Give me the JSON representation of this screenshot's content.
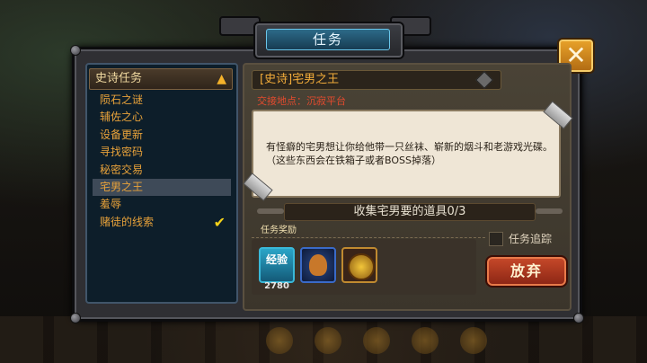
{
  "window": {
    "title": "任务"
  },
  "list": {
    "category": "史诗任务",
    "items": [
      {
        "label": "陨石之谜",
        "selected": false,
        "completed": false
      },
      {
        "label": "辅佐之心",
        "selected": false,
        "completed": false
      },
      {
        "label": "设备更新",
        "selected": false,
        "completed": false
      },
      {
        "label": "寻找密码",
        "selected": false,
        "completed": false
      },
      {
        "label": "秘密交易",
        "selected": false,
        "completed": false
      },
      {
        "label": "宅男之王",
        "selected": true,
        "completed": false
      },
      {
        "label": "羞辱",
        "selected": false,
        "completed": false
      },
      {
        "label": "赌徒的线索",
        "selected": false,
        "completed": true
      }
    ]
  },
  "quest": {
    "title": "[史诗]宅男之王",
    "location": "交接地点：沉寂平台",
    "description": "有怪癖的宅男想让你给他带一只丝袜、崭新的烟斗和老游戏光碟。（这些东西会在铁箱子或者BOSS掉落）",
    "objective": "收集宅男要的道具0/3",
    "rewards_label": "任务奖励",
    "rewards": [
      {
        "icon": "exp-icon",
        "label": "经验",
        "amount": "2780"
      },
      {
        "icon": "money-bag-icon"
      },
      {
        "icon": "medal-icon"
      }
    ],
    "track_label": "任务追踪",
    "abandon_label": "放弃"
  },
  "colors": {
    "accent": "#e8a23a",
    "title_bar": "#2c6a88",
    "close": "#e9a32a",
    "abandon": "#c84a2a"
  }
}
